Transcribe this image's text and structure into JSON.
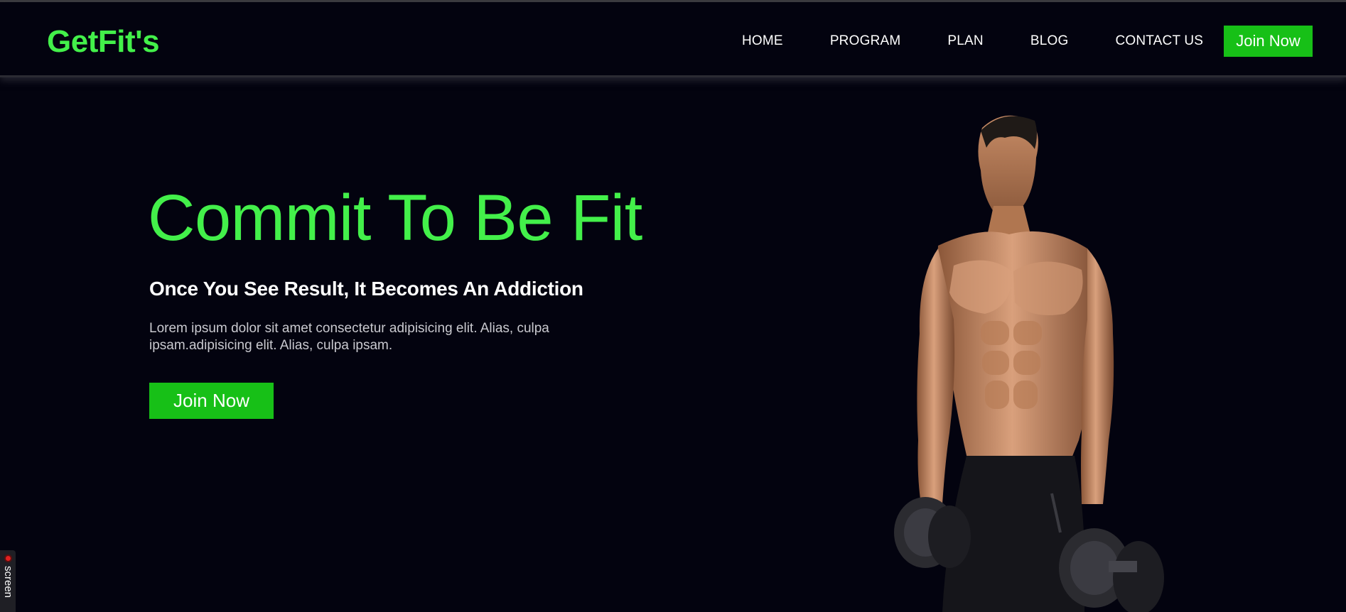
{
  "brand": {
    "name": "GetFit's",
    "accent_color": "#43f04a",
    "cta_color": "#17c017"
  },
  "nav": {
    "items": [
      {
        "label": "HOME"
      },
      {
        "label": "PROGRAM"
      },
      {
        "label": "PLAN"
      },
      {
        "label": "BLOG"
      },
      {
        "label": "CONTACT US"
      }
    ],
    "cta_label": "Join Now"
  },
  "hero": {
    "title": "Commit To Be Fit",
    "subtitle": "Once You See Result, It Becomes An Addiction",
    "body": "Lorem ipsum dolor sit amet consectetur adipisicing elit. Alias, culpa ipsam.adipisicing elit. Alias, culpa ipsam.",
    "cta_label": "Join Now",
    "image_icon": "athlete-with-dumbbells"
  },
  "recorder": {
    "label": "screen",
    "icon": "record-dot-icon"
  }
}
